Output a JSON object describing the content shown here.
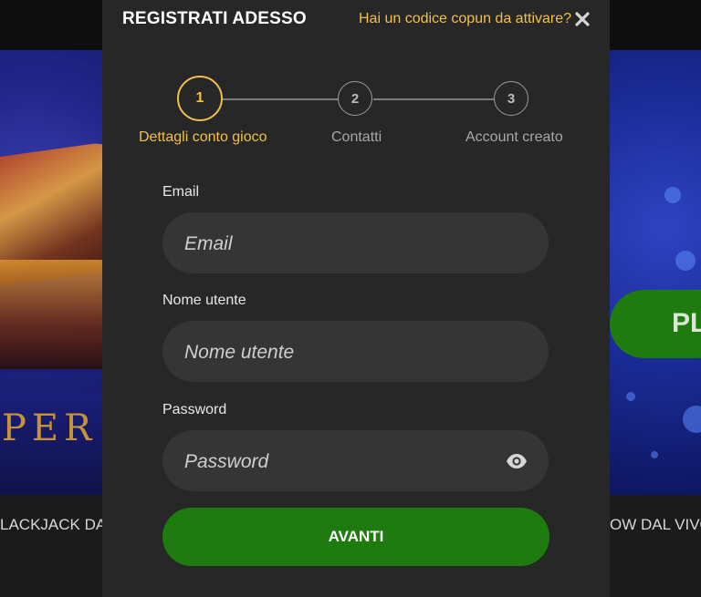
{
  "background": {
    "left_caption": "LACKJACK DA",
    "right_caption": "OW DAL VIVO",
    "right_button_label": "PL",
    "left_tile_text": "PER"
  },
  "modal": {
    "title": "REGISTRATI ADESSO",
    "coupon_link": "Hai un codice copun da attivare?",
    "close_icon": "close-icon"
  },
  "stepper": {
    "steps": [
      {
        "number": "1",
        "label": "Dettagli conto gioco",
        "state": "active"
      },
      {
        "number": "2",
        "label": "Contatti",
        "state": "inactive"
      },
      {
        "number": "3",
        "label": "Account creato",
        "state": "inactive"
      }
    ]
  },
  "form": {
    "email": {
      "label": "Email",
      "placeholder": "Email",
      "value": ""
    },
    "username": {
      "label": "Nome utente",
      "placeholder": "Nome utente",
      "value": ""
    },
    "password": {
      "label": "Password",
      "placeholder": "Password",
      "value": "",
      "toggle_icon": "eye-icon"
    },
    "submit_label": "AVANTI"
  },
  "colors": {
    "accent": "#f0c04a",
    "primary_button": "#1f7a0f",
    "modal_bg": "#272727",
    "field_bg": "#353535"
  }
}
